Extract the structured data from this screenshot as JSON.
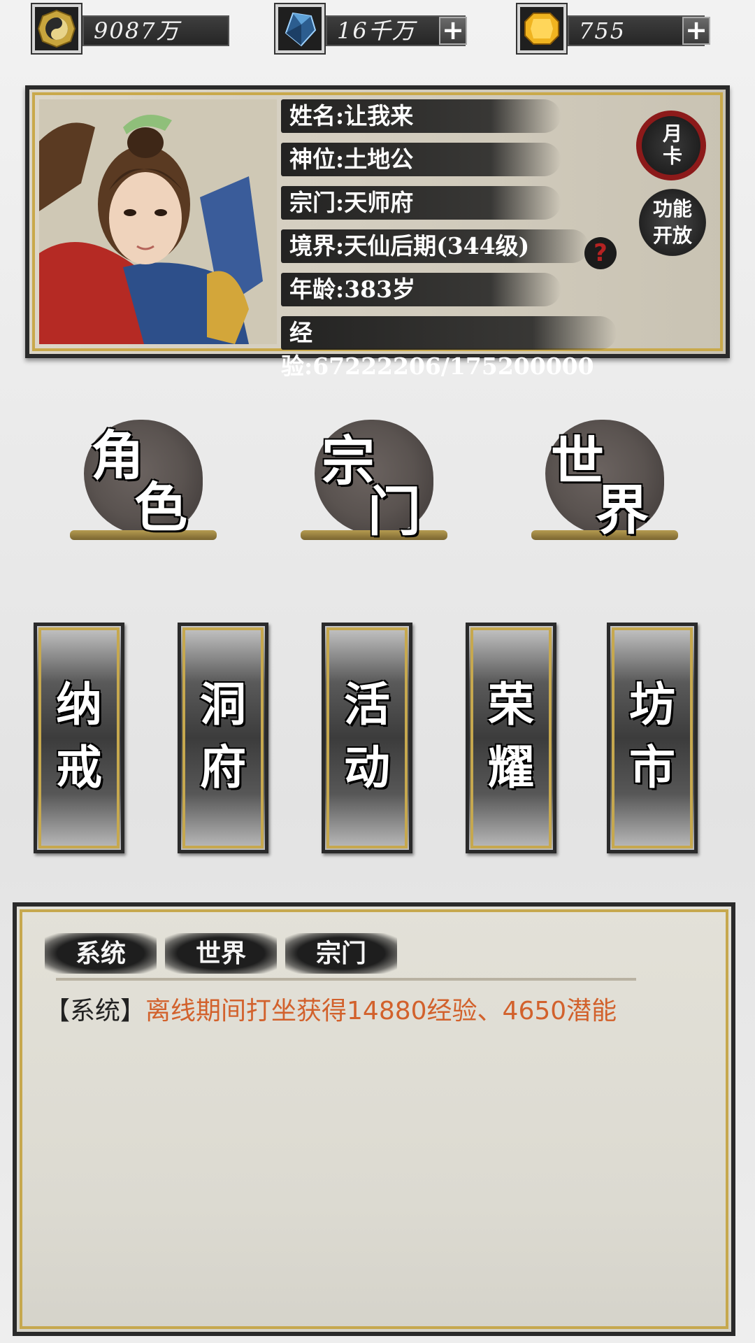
{
  "currencies": [
    {
      "icon": "yin-yang-coin-icon",
      "value": "9087万",
      "has_plus": false
    },
    {
      "icon": "blue-crystal-icon",
      "value": "16千万",
      "has_plus": true
    },
    {
      "icon": "gold-gem-icon",
      "value": "755",
      "has_plus": true
    }
  ],
  "plus_label": "+",
  "profile": {
    "name_label": "姓名:",
    "name": "让我来",
    "rank_label": "神位:",
    "rank": "土地公",
    "sect_label": "宗门:",
    "sect": "天师府",
    "realm_label": "境界:",
    "realm": "天仙后期(344级)",
    "age_label": "年龄:",
    "age": "383岁",
    "exp_label": "经验:",
    "exp": "67222206/175200000",
    "help_label": "?"
  },
  "side_buttons": {
    "month_card": "月卡",
    "func_open_line1": "功能",
    "func_open_line2": "开放"
  },
  "main_buttons": [
    {
      "c1": "角",
      "c2": "色"
    },
    {
      "c1": "宗",
      "c2": "门"
    },
    {
      "c1": "世",
      "c2": "界"
    }
  ],
  "menu_cards": [
    {
      "c1": "纳",
      "c2": "戒"
    },
    {
      "c1": "洞",
      "c2": "府"
    },
    {
      "c1": "活",
      "c2": "动"
    },
    {
      "c1": "荣",
      "c2": "耀"
    },
    {
      "c1": "坊",
      "c2": "市"
    }
  ],
  "chat": {
    "tabs": [
      "系统",
      "世界",
      "宗门"
    ],
    "messages": [
      {
        "tag": "【系统】",
        "text": "离线期间打坐获得14880经验、4650潜能"
      }
    ]
  },
  "colors": {
    "gold_frame": "#c6a84e",
    "message_orange": "#d2612c",
    "seal_red": "#8c1a1a"
  }
}
